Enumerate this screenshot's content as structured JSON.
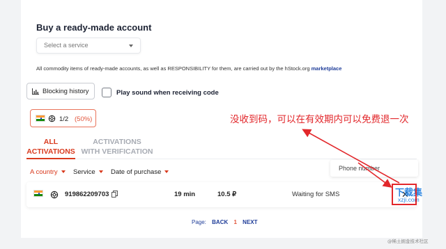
{
  "section": {
    "title": "Buy a ready-made account",
    "service_select": {
      "placeholder": "Select a service"
    },
    "notice_text": "All commodity items of ready-made accounts, as well as RESPONSIBILITY for them, are carried out by the hStock.org ",
    "notice_link": "marketplace"
  },
  "controls": {
    "blocking_history_label": "Blocking history",
    "play_sound_label": "Play sound when receiving code",
    "play_sound_checked": false
  },
  "country_chip": {
    "flag": "india-flag",
    "service_icon": "openai-icon",
    "count": "1/2",
    "percent": "(50%)"
  },
  "tabs": [
    {
      "line1": "ALL",
      "line2": "ACTIVATIONS",
      "active": true
    },
    {
      "line1": "ACTIVATIONS",
      "line2": "WITH VERIFICATION",
      "active": false
    }
  ],
  "filters": {
    "country": "A country",
    "service": "Service",
    "date": "Date of purchase",
    "phone_placeholder": "Phone number"
  },
  "activations": [
    {
      "flag": "india-flag",
      "service_icon": "openai-icon",
      "phone": "919862209703",
      "time": "19 min",
      "price": "10.5 ₽",
      "status": "Waiting for SMS",
      "action_icon": "close-icon"
    }
  ],
  "pagination": {
    "label": "Page:",
    "back": "BACK",
    "current": "1",
    "next": "NEXT"
  },
  "annotation": {
    "text": "没收到码，可以在有效期内可以免费退一次",
    "color": "#e2272b"
  },
  "watermark": {
    "brand": "下载集",
    "domain": "xzji.com",
    "source": "@稀土掘金技术社区"
  },
  "colors": {
    "accent": "#d93a1e",
    "link": "#1f3d99",
    "annotation": "#e2272b"
  }
}
